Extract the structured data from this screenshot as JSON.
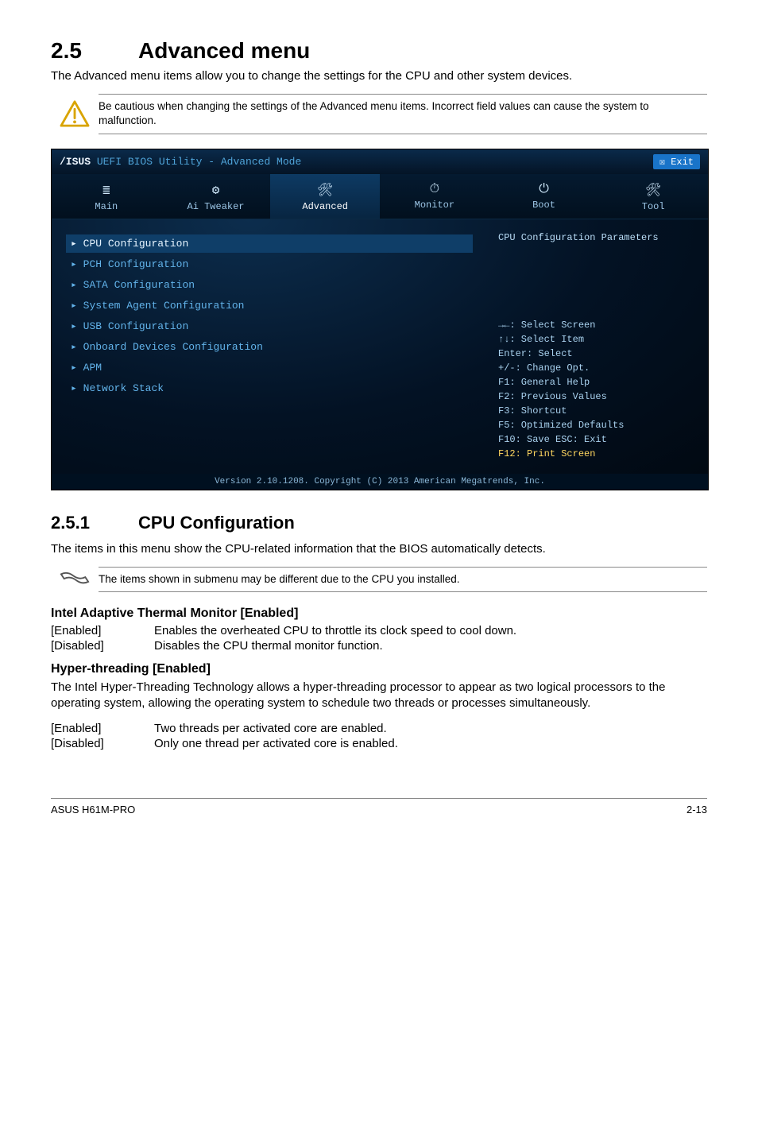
{
  "section": {
    "number": "2.5",
    "title": "Advanced menu",
    "intro": "The Advanced menu items allow you to change the settings for the CPU and other system devices."
  },
  "warning": {
    "text": "Be cautious when changing the settings of the Advanced menu items. Incorrect field values can cause the system to malfunction."
  },
  "bios": {
    "brand": "/ISUS",
    "title_rest": " UEFI BIOS Utility - Advanced Mode",
    "exit_label": "Exit",
    "tabs": [
      {
        "icon": "≣",
        "label": "Main"
      },
      {
        "icon": "⚙",
        "label": "Ai Tweaker"
      },
      {
        "icon": "🛠",
        "label": "Advanced"
      },
      {
        "icon": "⏱",
        "label": "Monitor"
      },
      {
        "icon": "⏻",
        "label": "Boot"
      },
      {
        "icon": "🛠",
        "label": "Tool"
      }
    ],
    "active_tab_index": 2,
    "left_items": [
      "CPU Configuration",
      "PCH Configuration",
      "SATA Configuration",
      "System Agent Configuration",
      "USB Configuration",
      "Onboard Devices Configuration",
      "APM",
      "Network Stack"
    ],
    "left_selected_index": 0,
    "right_title": "CPU Configuration Parameters",
    "help_keys": [
      "→←: Select Screen",
      "↑↓: Select Item",
      "Enter: Select",
      "+/-: Change Opt.",
      "F1: General Help",
      "F2: Previous Values",
      "F3: Shortcut",
      "F5: Optimized Defaults",
      "F10: Save  ESC: Exit",
      "F12: Print Screen"
    ],
    "footer": "Version 2.10.1208. Copyright (C) 2013 American Megatrends, Inc."
  },
  "sub": {
    "number": "2.5.1",
    "title": "CPU Configuration",
    "intro": "The items in this menu show the CPU-related information that the BIOS automatically detects."
  },
  "note": {
    "text": "The items shown in submenu may be different due to the CPU you installed."
  },
  "param1": {
    "heading": "Intel Adaptive Thermal Monitor [Enabled]",
    "rows": [
      {
        "k": "[Enabled]",
        "v": "Enables the overheated CPU to throttle its clock speed to cool down."
      },
      {
        "k": "[Disabled]",
        "v": "Disables the CPU thermal monitor function."
      }
    ]
  },
  "param2": {
    "heading": "Hyper-threading [Enabled]",
    "intro": "The Intel Hyper-Threading Technology allows a hyper-threading processor to appear as two logical processors to the operating system, allowing the operating system to schedule two threads or processes simultaneously.",
    "rows": [
      {
        "k": "[Enabled]",
        "v": "Two threads per activated core are enabled."
      },
      {
        "k": "[Disabled]",
        "v": "Only one thread per activated core is enabled."
      }
    ]
  },
  "footer": {
    "left": "ASUS H61M-PRO",
    "right": "2-13"
  }
}
